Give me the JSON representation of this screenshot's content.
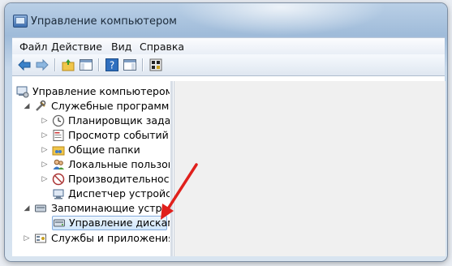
{
  "window": {
    "title": "Управление компьютером"
  },
  "menu": {
    "items": [
      "Файл",
      "Действие",
      "Вид",
      "Справка"
    ]
  },
  "toolbar": {
    "buttons": [
      "back-icon",
      "forward-icon",
      "up-folder-icon",
      "show-hide-console-tree-icon",
      "help-icon",
      "show-hide-action-pane-icon",
      "properties-icon"
    ]
  },
  "tree": {
    "root": "Управление компьютером (л",
    "system_tools": "Служебные программы",
    "task_scheduler": "Планировщик заданий",
    "event_viewer": "Просмотр событий",
    "shared_folders": "Общие папки",
    "local_users": "Локальные пользовате",
    "performance": "Производительность",
    "device_manager": "Диспетчер устройств",
    "storage": "Запоминающие устрой",
    "disk_management": "Управление дисками",
    "services": "Службы и приложения"
  },
  "annotation": {
    "arrow_color": "#e0201c"
  }
}
